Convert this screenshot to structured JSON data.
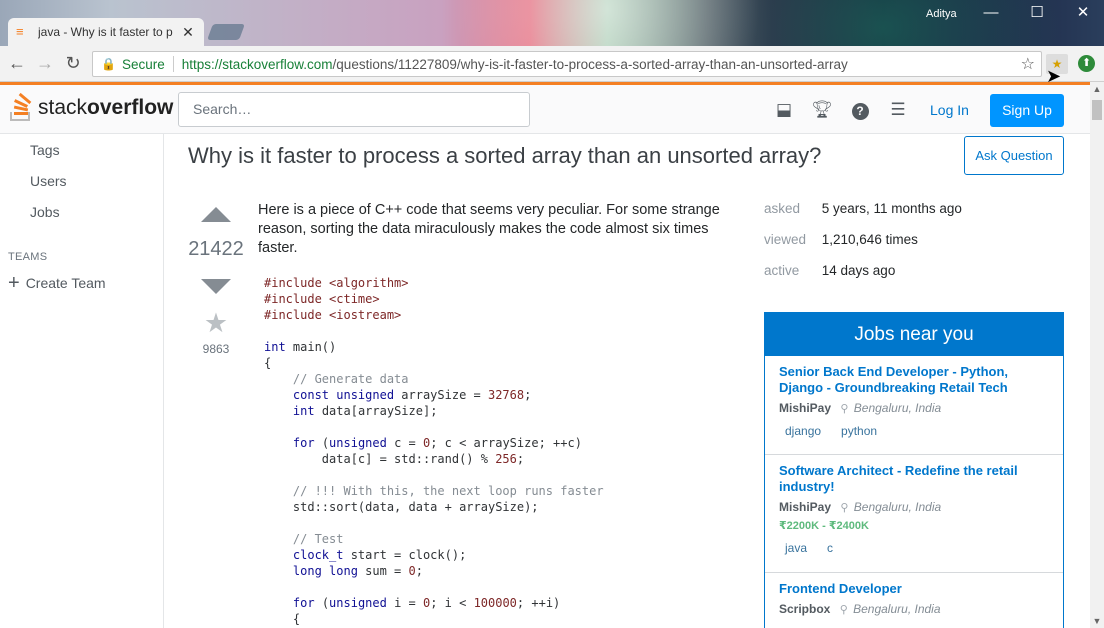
{
  "browser": {
    "tab_title": "java - Why is it faster to p",
    "user": "Aditya",
    "secure_label": "Secure",
    "url_host": "https://stackoverflow.com",
    "url_path": "/questions/11227809/why-is-it-faster-to-process-a-sorted-array-than-an-unsorted-array"
  },
  "topbar": {
    "logo_light": "stack",
    "logo_bold": "overflow",
    "search_placeholder": "Search…",
    "login": "Log In",
    "signup": "Sign Up"
  },
  "sidebar": {
    "items": [
      {
        "label": "Tags"
      },
      {
        "label": "Users"
      },
      {
        "label": "Jobs"
      }
    ],
    "teams_heading": "TEAMS",
    "create_team": "Create Team"
  },
  "question": {
    "title": "Why is it faster to process a sorted array than an unsorted array?",
    "ask_button": "Ask Question",
    "votes": "21422",
    "favorites": "9863",
    "body": "Here is a piece of C++ code that seems very peculiar. For some strange reason, sorting the data miraculously makes the code almost six times faster."
  },
  "stats": {
    "asked_label": "asked",
    "asked_value": "5 years, 11 months ago",
    "viewed_label": "viewed",
    "viewed_value": "1,210,646 times",
    "active_label": "active",
    "active_value": "14 days ago"
  },
  "jobs": {
    "header": "Jobs near you",
    "items": [
      {
        "title": "Senior Back End Developer - Python, Django - Groundbreaking Retail Tech",
        "company": "MishiPay",
        "location": "Bengaluru, India",
        "salary": "",
        "tags": [
          "django",
          "python"
        ]
      },
      {
        "title": "Software Architect - Redefine the retail industry!",
        "company": "MishiPay",
        "location": "Bengaluru, India",
        "salary": "₹2200K - ₹2400K",
        "tags": [
          "java",
          "c"
        ]
      },
      {
        "title": "Frontend Developer",
        "company": "Scripbox",
        "location": "Bengaluru, India",
        "salary": "",
        "tags": []
      }
    ]
  }
}
